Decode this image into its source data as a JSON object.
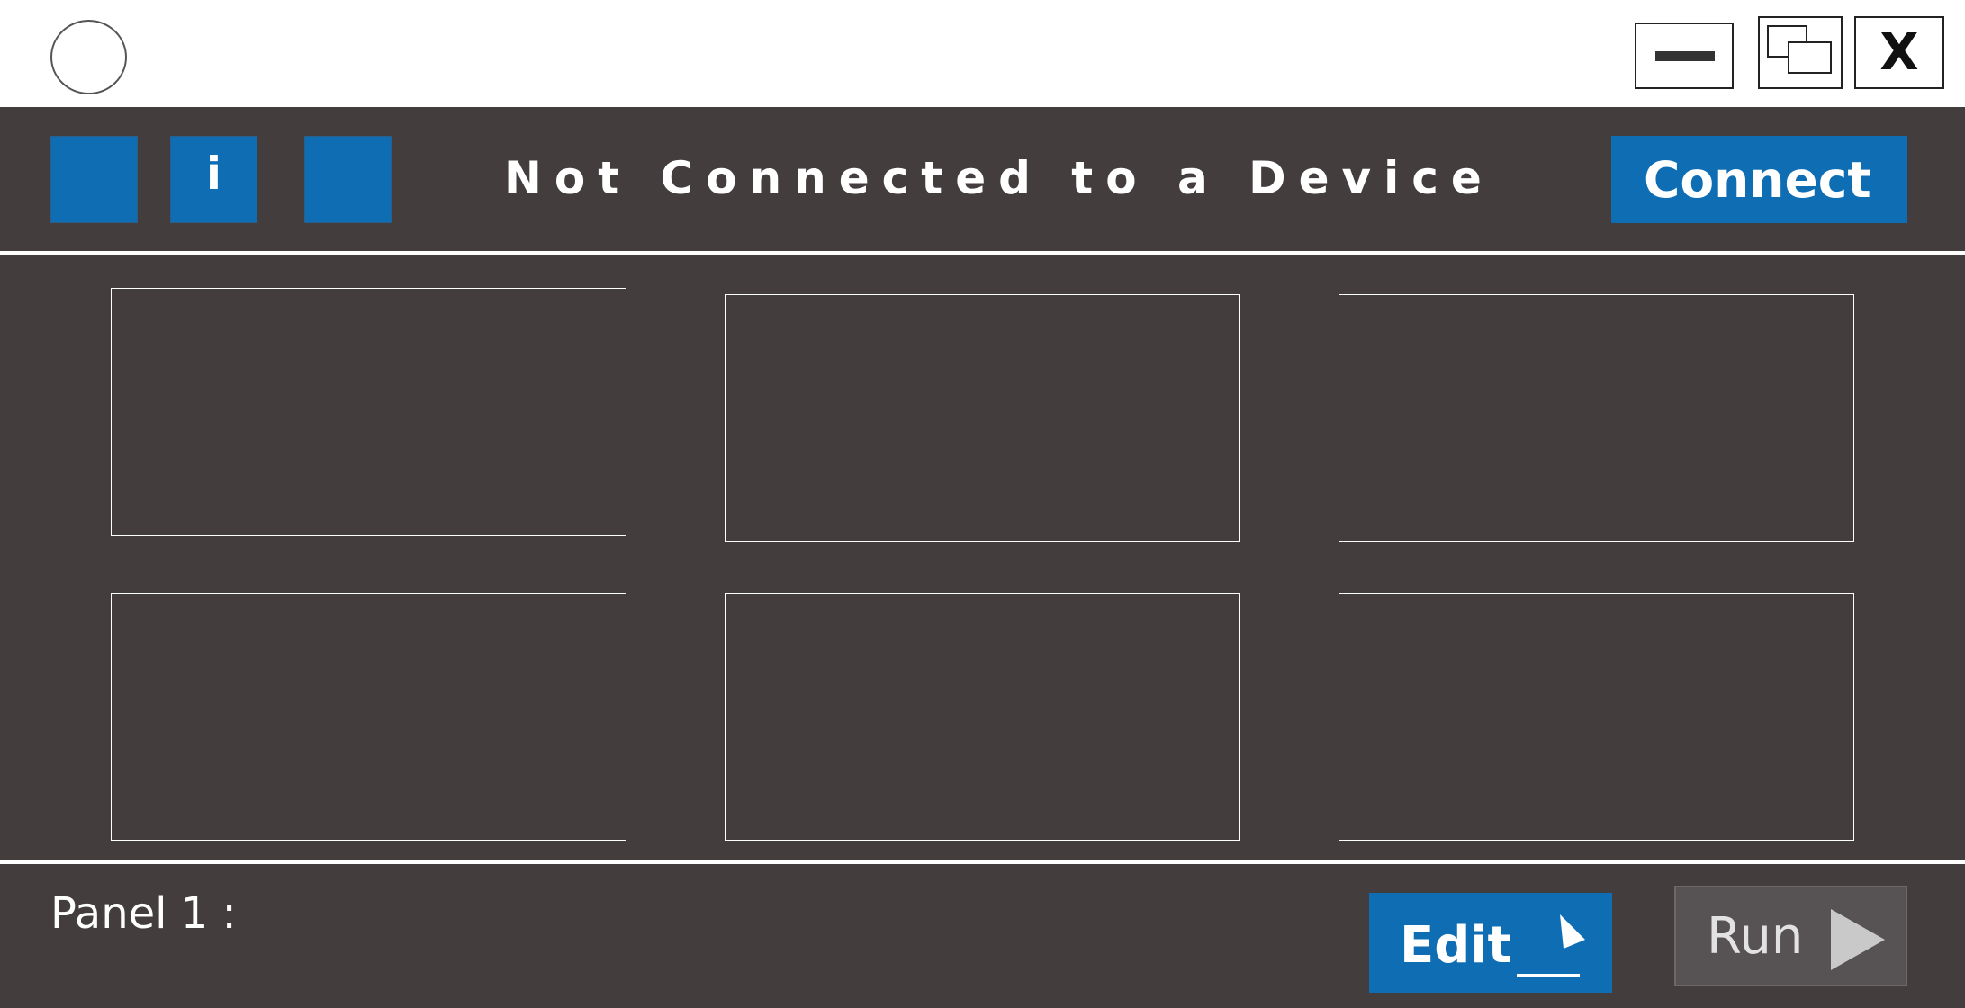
{
  "titlebar": {
    "app_icon": "circle-icon",
    "minimize_icon": "minimize-icon",
    "restore_icon": "restore-icon",
    "close_label": "X"
  },
  "header": {
    "tool_buttons": [
      {
        "icon": "blank-square-icon"
      },
      {
        "icon": "info-icon",
        "label": "i"
      },
      {
        "icon": "blank-square-icon"
      }
    ],
    "status": "Not Connected to a Device",
    "connect_label": "Connect"
  },
  "panel_slots_count": 6,
  "footer": {
    "panel_label": "Panel 1 :",
    "edit_label": "Edit",
    "edit_icon": "pencil-icon",
    "run_label": "Run",
    "run_icon": "play-icon"
  },
  "colors": {
    "accent": "#0f6db3",
    "background": "#443d3e",
    "run_button": "#575253",
    "titlebar": "#ffffff"
  }
}
